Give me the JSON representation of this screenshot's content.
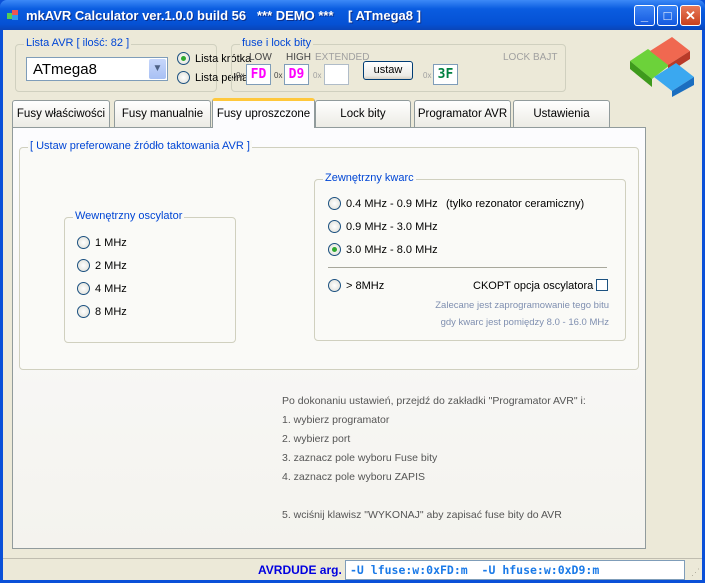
{
  "window": {
    "title": "mkAVR Calculator ver.1.0.0 build 56   *** DEMO ***    [ ATmega8 ]",
    "minimize": "_",
    "maximize": "□",
    "close": "✕"
  },
  "avr_list": {
    "label": "Lista AVR [ ilość: 82 ]",
    "selected": "ATmega8",
    "short_list": "Lista krótka",
    "full_list": "Lista pełna"
  },
  "fuses": {
    "label": "fuse i lock bity",
    "low_label": "LOW",
    "high_label": "HIGH",
    "ext_label": "EXTENDED",
    "lock_label": "LOCK BAJT",
    "prefix": "0x",
    "low": "FD",
    "high": "D9",
    "ext": "",
    "lock": "3F",
    "set_button": "ustaw",
    "low_color": "#ff00ff",
    "lock_color": "#008040"
  },
  "tabs": [
    "Fusy właściwości",
    "Fusy manualnie",
    "Fusy uproszczone",
    "Lock bity",
    "Programator AVR",
    "Ustawienia"
  ],
  "panel": {
    "group_label": "[ Ustaw preferowane źródło taktowania AVR ]",
    "internal": {
      "label": "Wewnętrzny oscylator",
      "options": [
        "1 MHz",
        "2 MHz",
        "4 MHz",
        "8 MHz"
      ]
    },
    "external": {
      "label": "Zewnętrzny kwarc",
      "options": [
        "0.4 MHz - 0.9 MHz",
        "0.9 MHz - 3.0 MHz",
        "3.0 MHz - 8.0 MHz",
        "> 8MHz"
      ],
      "note_ceramic": "(tylko rezonator ceramiczny)",
      "ckopt_label": "CKOPT opcja oscylatora",
      "note1": "Zalecane jest zaprogramowanie tego bitu",
      "note2": "gdy kwarc jest pomiędzy 8.0 - 16.0 MHz"
    },
    "instructions": [
      "Po dokonaniu ustawień, przejdź do zakładki \"Programator AVR\" i:",
      "1. wybierz programator",
      "2. wybierz port",
      "3. zaznacz pole wyboru Fuse bity",
      "4. zaznacz pole wyboru ZAPIS",
      "5. wciśnij klawisz \"WYKONAJ\" aby zapisać fuse bity do AVR"
    ]
  },
  "status": {
    "label": "AVRDUDE arg.",
    "value": "-U lfuse:w:0xFD:m  -U hfuse:w:0xD9:m"
  }
}
